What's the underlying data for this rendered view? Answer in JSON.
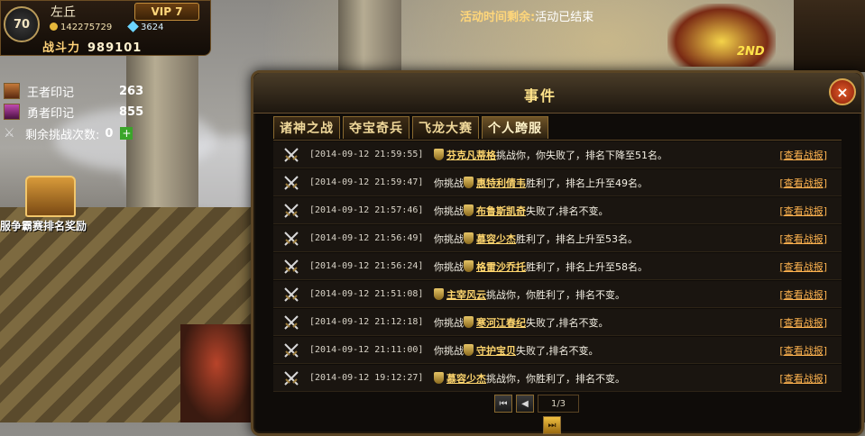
{
  "player": {
    "level": "70",
    "name": "左丘",
    "vip": "VIP 7",
    "gold": "142275729",
    "diamonds": "3624",
    "power_label": "战斗力",
    "power_value": "989101"
  },
  "marks": [
    {
      "label": "王者印记",
      "value": "263"
    },
    {
      "label": "勇者印记",
      "value": "855"
    },
    {
      "label": "剩余挑战次数:",
      "value": "0"
    }
  ],
  "reward_label": "服争霸赛排名奖励",
  "activity": {
    "label": "活动时间剩余:",
    "value": "活动已结束"
  },
  "rank_tag": "2ND",
  "window": {
    "title": "事件",
    "tabs": [
      "诸神之战",
      "夺宝奇兵",
      "飞龙大赛",
      "个人跨服"
    ],
    "active_tab": 3,
    "report_label": "[查看战报]",
    "events": [
      {
        "time": "[2014-09-12 21:59:55]",
        "pre": "",
        "opponent": "芬克凡蒂格",
        "post": "挑战你，你失败了，排名下降至51名。"
      },
      {
        "time": "[2014-09-12 21:59:47]",
        "pre": "你挑战",
        "opponent": "惠特利倩韦",
        "post": "胜利了，排名上升至49名。"
      },
      {
        "time": "[2014-09-12 21:57:46]",
        "pre": "你挑战",
        "opponent": "布鲁斯凯奇",
        "post": "失败了,排名不变。"
      },
      {
        "time": "[2014-09-12 21:56:49]",
        "pre": "你挑战",
        "opponent": "慕容少杰",
        "post": "胜利了，排名上升至53名。"
      },
      {
        "time": "[2014-09-12 21:56:24]",
        "pre": "你挑战",
        "opponent": "格雷沙乔托",
        "post": "胜利了，排名上升至58名。"
      },
      {
        "time": "[2014-09-12 21:51:08]",
        "pre": "",
        "opponent": "主宰风云",
        "post": "挑战你，你胜利了，排名不变。"
      },
      {
        "time": "[2014-09-12 21:12:18]",
        "pre": "你挑战",
        "opponent": "寒河江春纪",
        "post": "失败了,排名不变。"
      },
      {
        "time": "[2014-09-12 21:11:00]",
        "pre": "你挑战",
        "opponent": "守护宝贝",
        "post": "失败了,排名不变。"
      },
      {
        "time": "[2014-09-12 19:12:27]",
        "pre": "",
        "opponent": "慕容少杰",
        "post": "挑战你，你胜利了，排名不变。"
      }
    ],
    "pager": {
      "page": "1/3"
    }
  },
  "colors": {
    "accent": "#ffd66e",
    "report": "#ffb450",
    "frame": "#5a4424"
  }
}
